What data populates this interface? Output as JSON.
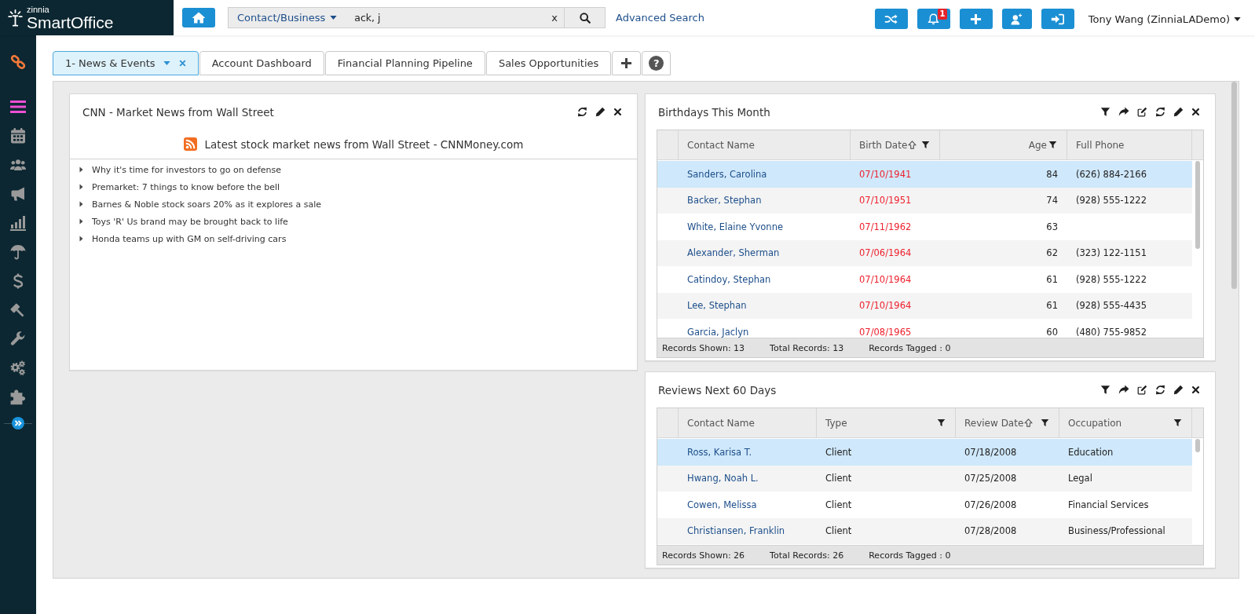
{
  "brand": {
    "tagline": "zinnia",
    "name": "SmartOffice"
  },
  "header": {
    "search": {
      "scope": "Contact/Business",
      "value": "ack, j",
      "clear": "x"
    },
    "advanced_search": "Advanced Search",
    "notification_count": "1",
    "user": "Tony Wang (ZinniaLADemo)"
  },
  "tab_bar": {
    "tabs": [
      {
        "label": "1- News & Events",
        "selected": true
      },
      {
        "label": "Account Dashboard",
        "selected": false
      },
      {
        "label": "Financial Planning Pipeline",
        "selected": false
      },
      {
        "label": "Sales Opportunities",
        "selected": false
      }
    ],
    "help": "?"
  },
  "dashboard": {
    "columns": [
      {
        "widgets": [
          {
            "kind": "rss",
            "title": "CNN - Market News from Wall Street",
            "feed_title": "Latest stock market news from Wall Street - CNNMoney.com",
            "items": [
              "Why it's time for investors to go on defense",
              "Premarket: 7 things to know before the bell",
              "Barnes & Noble stock soars 20% as it explores a sale",
              "Toys 'R' Us brand may be brought back to life",
              "Honda teams up with GM on self-driving cars"
            ]
          }
        ]
      },
      {
        "widgets": [
          {
            "kind": "grid",
            "title": "Birthdays This Month",
            "columns": [
              {
                "label": "Contact Name",
                "kind": "link",
                "sorted": false,
                "filter": false
              },
              {
                "label": "Birth Date",
                "kind": "highlight",
                "sorted": true,
                "filter": true
              },
              {
                "label": "Age",
                "kind": "number",
                "sorted": false,
                "filter": true
              },
              {
                "label": "Full Phone",
                "kind": "text",
                "sorted": false,
                "filter": false
              }
            ],
            "rows": [
              {
                "selected": true,
                "cells": [
                  "Sanders, Carolina",
                  "07/10/1941",
                  "84",
                  "(626) 884-2166"
                ]
              },
              {
                "selected": false,
                "cells": [
                  "Backer, Stephan",
                  "07/10/1951",
                  "74",
                  "(928) 555-1222"
                ]
              },
              {
                "selected": false,
                "cells": [
                  "White, Elaine Yvonne",
                  "07/11/1962",
                  "63",
                  null
                ]
              },
              {
                "selected": false,
                "cells": [
                  "Alexander, Sherman",
                  "07/06/1964",
                  "62",
                  "(323) 122-1151"
                ]
              },
              {
                "selected": false,
                "cells": [
                  "Catindoy, Stephan",
                  "07/10/1964",
                  "61",
                  "(928) 555-1222"
                ]
              },
              {
                "selected": false,
                "cells": [
                  "Lee, Stephan",
                  "07/10/1964",
                  "61",
                  "(928) 555-4435"
                ]
              },
              {
                "selected": false,
                "cells": [
                  "Garcia, Jaclyn",
                  "07/08/1965",
                  "60",
                  "(480) 755-9852"
                ]
              }
            ],
            "footer": [
              "Records Shown: 13",
              "Total Records: 13",
              "Records Tagged : 0"
            ]
          },
          {
            "kind": "grid",
            "title": "Reviews Next 60 Days",
            "columns": [
              {
                "label": "Contact Name",
                "kind": "link",
                "sorted": false,
                "filter": false
              },
              {
                "label": "Type",
                "kind": "text",
                "sorted": false,
                "filter": true
              },
              {
                "label": "Review Date",
                "kind": "text",
                "sorted": true,
                "filter": true
              },
              {
                "label": "Occupation",
                "kind": "text",
                "sorted": false,
                "filter": true
              }
            ],
            "rows": [
              {
                "selected": true,
                "cells": [
                  "Ross, Karisa T.",
                  "Client",
                  "07/18/2008",
                  "Education"
                ]
              },
              {
                "selected": false,
                "cells": [
                  "Hwang, Noah L.",
                  "Client",
                  "07/25/2008",
                  "Legal"
                ]
              },
              {
                "selected": false,
                "cells": [
                  "Cowen, Melissa",
                  "Client",
                  "07/26/2008",
                  "Financial Services"
                ]
              },
              {
                "selected": false,
                "cells": [
                  "Christiansen, Franklin",
                  "Client",
                  "07/28/2008",
                  "Business/Professional"
                ]
              }
            ],
            "footer": [
              "Records Shown: 26",
              "Total Records: 26",
              "Records Tagged : 0"
            ]
          }
        ]
      }
    ]
  }
}
